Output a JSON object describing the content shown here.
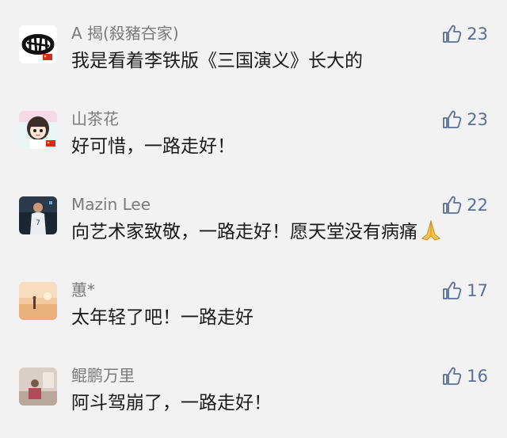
{
  "comments": [
    {
      "nickname": "A 揭(殺豬夻家)",
      "text": "我是看着李铁版《三国演义》长大的",
      "likes": "23",
      "avatar": "calligraphy-logo-avatar"
    },
    {
      "nickname": "山茶花",
      "text": "好可惜，一路走好！",
      "likes": "23",
      "avatar": "anime-girl-avatar"
    },
    {
      "nickname": "Mazin Lee",
      "text": "向艺术家致敬，一路走好！愿天堂没有病痛",
      "text_emoji": "folded-hands-emoji",
      "likes": "22",
      "avatar": "basketball-player-avatar"
    },
    {
      "nickname": "蕙*",
      "text": "太年轻了吧！一路走好",
      "likes": "17",
      "avatar": "beach-sunset-avatar"
    },
    {
      "nickname": "鲲鹏万里",
      "text": "阿斗驾崩了，一路走好！",
      "likes": "16",
      "avatar": "person-room-avatar"
    }
  ],
  "colors": {
    "background": "#f2f2f2",
    "nickname": "#7a7a7a",
    "text": "#1a1a1a",
    "like": "#5a6f95"
  }
}
